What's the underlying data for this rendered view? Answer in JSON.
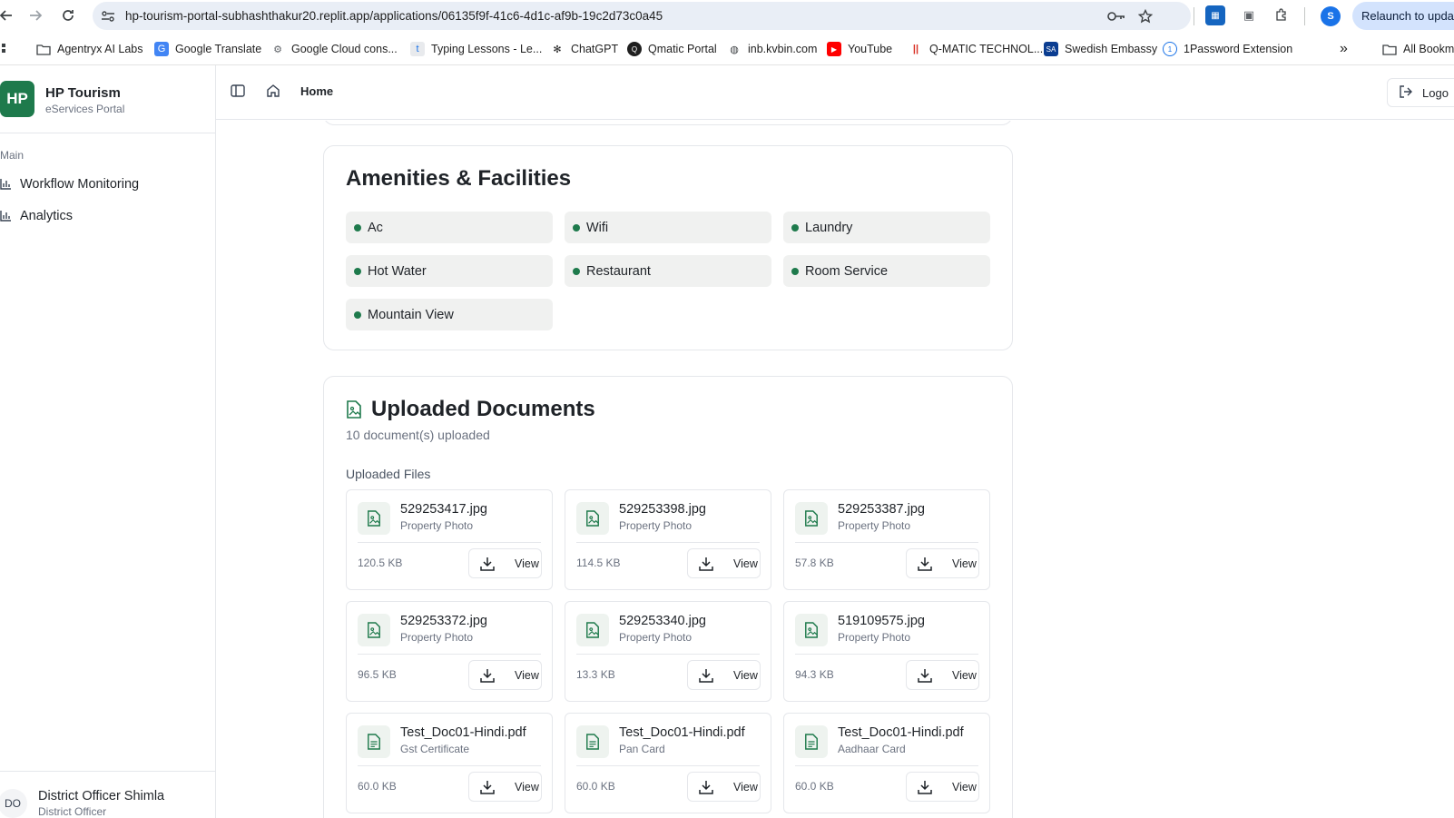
{
  "browser": {
    "url": "hp-tourism-portal-subhashthakur20.replit.app/applications/06135f9f-41c6-4d1c-af9b-19c2d73c0a45",
    "profile_initial": "S",
    "relaunch_label": "Relaunch to update",
    "bookmarks": [
      {
        "label": "Agentryx AI Labs",
        "icon": "folder-icon"
      },
      {
        "label": "Google Translate",
        "icon": "translate-icon"
      },
      {
        "label": "Google Cloud cons...",
        "icon": "cloud-icon"
      },
      {
        "label": "Typing Lessons - Le...",
        "icon": "typing-icon"
      },
      {
        "label": "ChatGPT",
        "icon": "chatgpt-icon"
      },
      {
        "label": "Qmatic Portal",
        "icon": "qmatic-icon"
      },
      {
        "label": "inb.kvbin.com",
        "icon": "globe-icon"
      },
      {
        "label": "YouTube",
        "icon": "youtube-icon"
      },
      {
        "label": "Q-MATIC TECHNOL...",
        "icon": "qmatic-tech-icon"
      },
      {
        "label": "Swedish Embassy",
        "icon": "embassy-icon"
      },
      {
        "label": "1Password Extension",
        "icon": "onepassword-icon"
      }
    ],
    "more_label": "»",
    "all_bookmarks_label": "All Bookm"
  },
  "sidebar": {
    "logo_text": "HP",
    "brand_name": "HP Tourism",
    "brand_sub": "eServices Portal",
    "section_label": "Main",
    "items": [
      {
        "label": "Workflow Monitoring",
        "icon": "bar-chart-icon"
      },
      {
        "label": "Analytics",
        "icon": "bar-chart-icon"
      }
    ],
    "user": {
      "initials": "DO",
      "name": "District Officer Shimla",
      "role": "District Officer"
    }
  },
  "topbar": {
    "breadcrumb": "Home",
    "logout_label": "Logo"
  },
  "amenities": {
    "title": "Amenities & Facilities",
    "items": [
      "Ac",
      "Wifi",
      "Laundry",
      "Hot Water",
      "Restaurant",
      "Room Service",
      "Mountain View"
    ]
  },
  "documents": {
    "title": "Uploaded Documents",
    "count_text": "10 document(s) uploaded",
    "files_label": "Uploaded Files",
    "view_label": "View",
    "files": [
      {
        "name": "529253417.jpg",
        "type": "Property Photo",
        "size": "120.5 KB",
        "kind": "image"
      },
      {
        "name": "529253398.jpg",
        "type": "Property Photo",
        "size": "114.5 KB",
        "kind": "image"
      },
      {
        "name": "529253387.jpg",
        "type": "Property Photo",
        "size": "57.8 KB",
        "kind": "image"
      },
      {
        "name": "529253372.jpg",
        "type": "Property Photo",
        "size": "96.5 KB",
        "kind": "image"
      },
      {
        "name": "529253340.jpg",
        "type": "Property Photo",
        "size": "13.3 KB",
        "kind": "image"
      },
      {
        "name": "519109575.jpg",
        "type": "Property Photo",
        "size": "94.3 KB",
        "kind": "image"
      },
      {
        "name": "Test_Doc01-Hindi.pdf",
        "type": "Gst Certificate",
        "size": "60.0 KB",
        "kind": "pdf"
      },
      {
        "name": "Test_Doc01-Hindi.pdf",
        "type": "Pan Card",
        "size": "60.0 KB",
        "kind": "pdf"
      },
      {
        "name": "Test_Doc01-Hindi.pdf",
        "type": "Aadhaar Card",
        "size": "60.0 KB",
        "kind": "pdf"
      }
    ]
  },
  "colors": {
    "brand": "#1e7a4c",
    "amenity_bg": "#f0f1f0",
    "border": "#e5e7eb"
  }
}
